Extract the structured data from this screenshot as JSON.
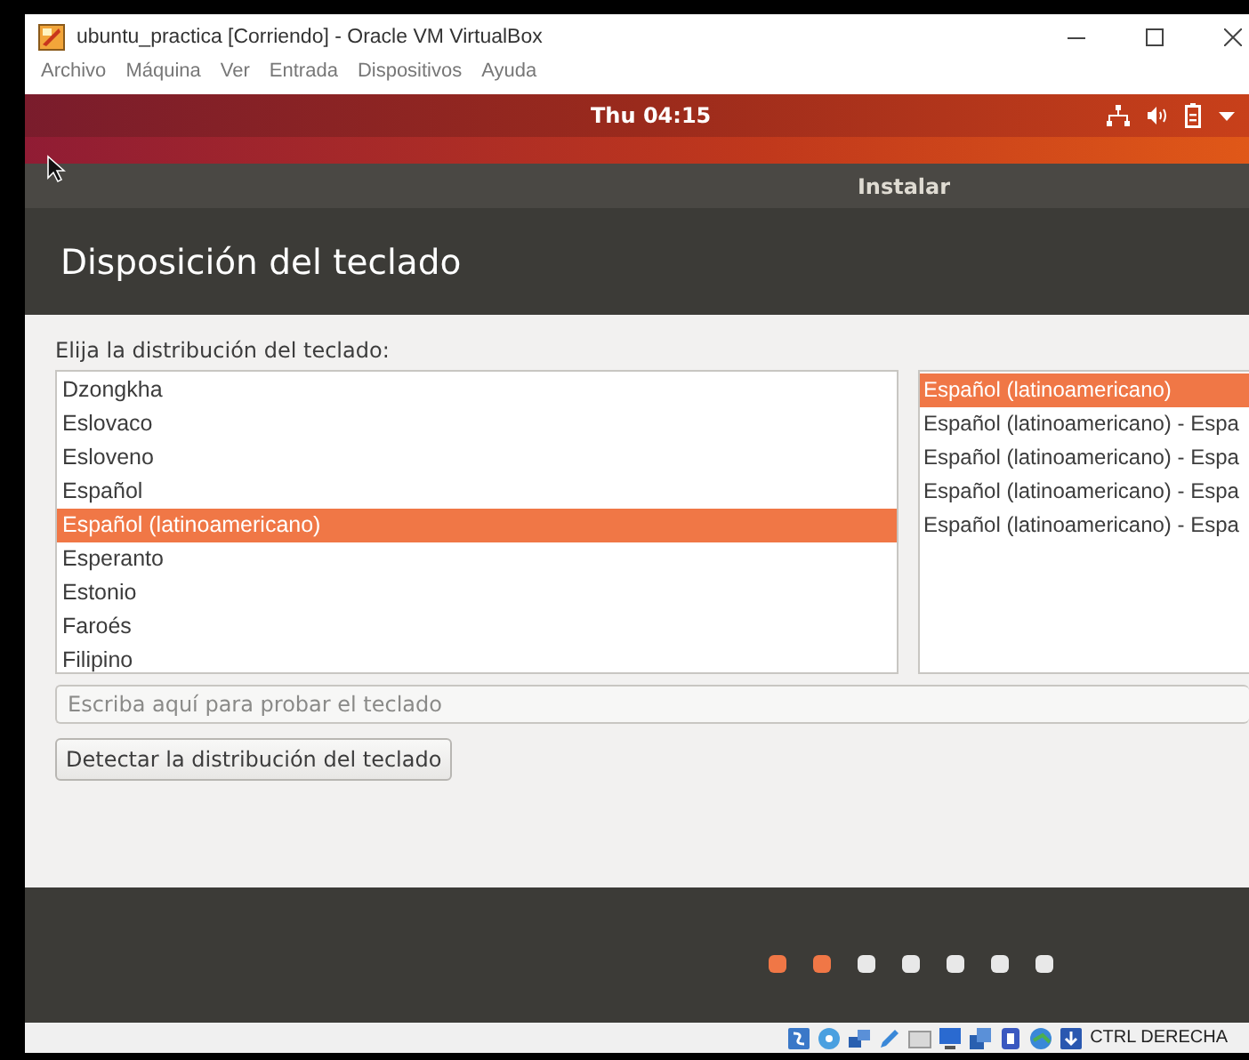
{
  "window": {
    "title": "ubuntu_practica [Corriendo] - Oracle VM VirtualBox"
  },
  "menu": [
    "Archivo",
    "Máquina",
    "Ver",
    "Entrada",
    "Dispositivos",
    "Ayuda"
  ],
  "top_bar": {
    "clock": "Thu 04:15"
  },
  "dialog": {
    "title": "Instalar",
    "heading": "Disposición del teclado",
    "prompt": "Elija la distribución del teclado:",
    "layouts": [
      {
        "label": "Dzongkha",
        "selected": false
      },
      {
        "label": "Eslovaco",
        "selected": false
      },
      {
        "label": "Esloveno",
        "selected": false
      },
      {
        "label": "Español",
        "selected": false
      },
      {
        "label": "Español (latinoamericano)",
        "selected": true
      },
      {
        "label": "Esperanto",
        "selected": false
      },
      {
        "label": "Estonio",
        "selected": false
      },
      {
        "label": "Faroés",
        "selected": false
      },
      {
        "label": "Filipino",
        "selected": false
      }
    ],
    "variants": [
      {
        "label": "Español (latinoamericano)",
        "selected": true
      },
      {
        "label": "Español (latinoamericano) - Espa",
        "selected": false
      },
      {
        "label": "Español (latinoamericano) - Espa",
        "selected": false
      },
      {
        "label": "Español (latinoamericano) - Espa",
        "selected": false
      },
      {
        "label": "Español (latinoamericano) - Espa",
        "selected": false
      }
    ],
    "test_field": {
      "placeholder": "Escriba aquí para probar el teclado"
    },
    "detect_button": "Detectar la distribución del teclado",
    "steps": [
      {
        "done": true
      },
      {
        "done": true
      },
      {
        "done": false
      },
      {
        "done": false
      },
      {
        "done": false
      },
      {
        "done": false
      },
      {
        "done": false
      }
    ]
  },
  "status_bar": {
    "host_key": "CTRL DERECHA"
  }
}
